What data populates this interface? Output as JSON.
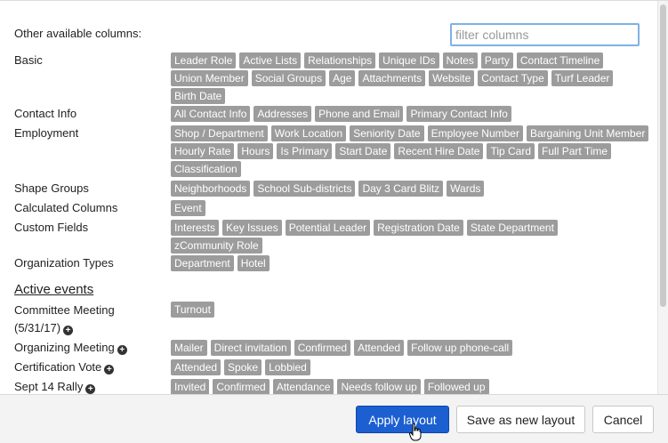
{
  "filter": {
    "placeholder": "filter columns"
  },
  "heading": "Other available columns:",
  "groups": [
    {
      "label": "Basic",
      "chips": [
        "Leader Role",
        "Active Lists",
        "Relationships",
        "Unique IDs",
        "Notes",
        "Party",
        "Contact Timeline",
        "Union Member",
        "Social Groups",
        "Age",
        "Attachments",
        "Website",
        "Contact Type",
        "Turf Leader",
        "Birth Date"
      ]
    },
    {
      "label": "Contact Info",
      "chips": [
        "All Contact Info",
        "Addresses",
        "Phone and Email",
        "Primary Contact Info"
      ]
    },
    {
      "label": "Employment",
      "chips": [
        "Shop / Department",
        "Work Location",
        "Seniority Date",
        "Employee Number",
        "Bargaining Unit Member",
        "Hourly Rate",
        "Hours",
        "Is Primary",
        "Start Date",
        "Recent Hire Date",
        "Tip Card",
        "Full Part Time",
        "Classification"
      ]
    },
    {
      "label": "Shape Groups",
      "chips": [
        "Neighborhoods",
        "School Sub-districts",
        "Day 3 Card Blitz",
        "Wards"
      ]
    },
    {
      "label": "Calculated Columns",
      "chips": [
        "Event"
      ]
    },
    {
      "label": "Custom Fields",
      "chips": [
        "Interests",
        "Key Issues",
        "Potential Leader",
        "Registration Date",
        "State Department",
        "zCommunity Role"
      ]
    },
    {
      "label": "Organization Types",
      "chips": [
        "Department",
        "Hotel"
      ]
    }
  ],
  "active_events": {
    "title": "Active events",
    "events": [
      {
        "label_line1": "Committee Meeting",
        "label_line2": "(5/31/17)",
        "chips": [
          "Turnout"
        ]
      },
      {
        "label": "Organizing Meeting",
        "chips": [
          "Mailer",
          "Direct invitation",
          "Confirmed",
          "Attended",
          "Follow up phone-call"
        ]
      },
      {
        "label": "Certification Vote",
        "chips": [
          "Attended",
          "Spoke",
          "Lobbied"
        ]
      },
      {
        "label": "Sept 14 Rally",
        "chips": [
          "Invited",
          "Confirmed",
          "Attendance",
          "Needs follow up",
          "Followed up"
        ]
      }
    ]
  },
  "footer": {
    "apply_label": "Apply layout",
    "save_label": "Save as new layout",
    "cancel_label": "Cancel"
  },
  "colors": {
    "chip_bg": "#9c9c9c",
    "apply_bg": "#1b5fd1",
    "focus_border": "#7fb2e5"
  }
}
